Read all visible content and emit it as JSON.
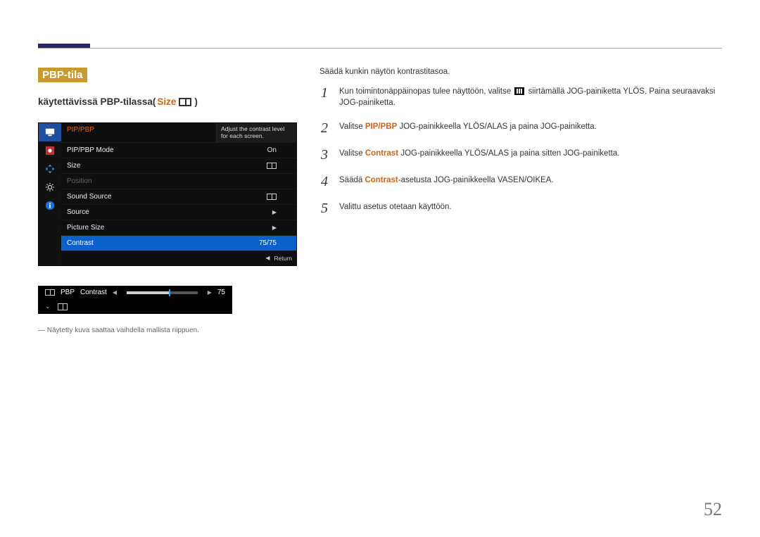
{
  "header": {
    "title": "PBP-tila"
  },
  "subhead": {
    "prefix": "käytettävissä PBP-tilassa(",
    "size_word": "Size",
    "suffix": "))",
    "full_suffix": ")"
  },
  "osd": {
    "menu_title": "PIP/PBP",
    "description": "Adjust the contrast level for each screen.",
    "rows": [
      {
        "label": "PIP/PBP Mode",
        "value": "On",
        "type": "text"
      },
      {
        "label": "Size",
        "value": "",
        "type": "pbp-icon"
      },
      {
        "label": "Position",
        "value": "",
        "type": "disabled"
      },
      {
        "label": "Sound Source",
        "value": "",
        "type": "pbp-icon"
      },
      {
        "label": "Source",
        "value": "",
        "type": "chev"
      },
      {
        "label": "Picture Size",
        "value": "",
        "type": "chev"
      },
      {
        "label": "Contrast",
        "value": "75/75",
        "type": "active"
      }
    ],
    "return": "Return"
  },
  "slider": {
    "source_label": "PBP",
    "param": "Contrast",
    "value": "75"
  },
  "footnote": "― Näytetty kuva saattaa vaihdella mallista riippuen.",
  "right": {
    "intro": "Säädä kunkin näytön kontrastitasoa.",
    "steps": [
      {
        "n": "1",
        "pre": "Kun toimintonäppäinopas tulee näyttöön, valitse ",
        "post": " siirtämällä JOG-painiketta YLÖS. Paina seuraavaksi JOG-painiketta."
      },
      {
        "n": "2",
        "pre": "Valitse ",
        "kw": "PIP/PBP",
        "post": " JOG-painikkeella YLÖS/ALAS ja paina JOG-painiketta."
      },
      {
        "n": "3",
        "pre": "Valitse ",
        "kw": "Contrast",
        "post": " JOG-painikkeella YLÖS/ALAS ja paina sitten JOG-painiketta."
      },
      {
        "n": "4",
        "pre": "Säädä ",
        "kw": "Contrast",
        "post": "-asetusta JOG-painikkeella VASEN/OIKEA."
      },
      {
        "n": "5",
        "pre": "Valittu asetus otetaan käyttöön.",
        "kw": "",
        "post": ""
      }
    ]
  },
  "page_number": "52"
}
